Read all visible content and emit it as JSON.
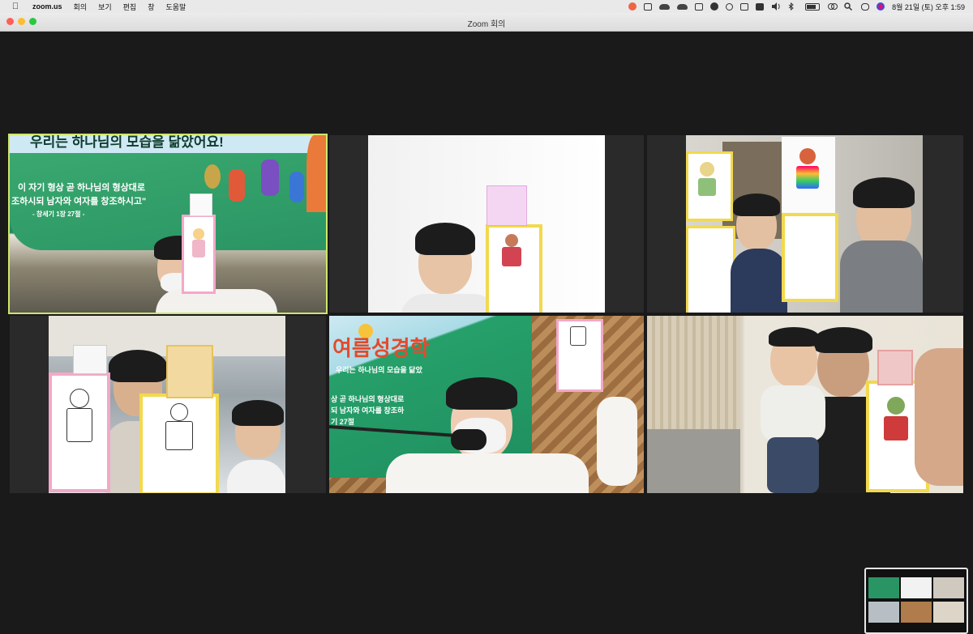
{
  "menubar": {
    "apple_icon": "apple-logo-icon",
    "app": "zoom.us",
    "menus": [
      "회의",
      "보기",
      "편집",
      "창",
      "도움말"
    ],
    "status_icons": [
      "zoom-share-icon",
      "camera-icon",
      "cloud-icon",
      "cloud-icon",
      "dashboard-icon",
      "contrast-icon",
      "play-icon",
      "window-icon",
      "translate-icon",
      "volume-icon",
      "bluetooth-icon",
      "battery-icon",
      "link-icon",
      "search-icon",
      "control-center-icon",
      "siri-icon"
    ],
    "clock": "8월 21일 (토) 오후 1:59"
  },
  "window": {
    "title": "Zoom 회의"
  },
  "tiles": {
    "t1": {
      "banner_line1": "우리는 하나님의 모습을 닮았어요!",
      "verse_line1": "이 자기 형상 곧 하나님의 형상대로",
      "verse_line2": "조하시되 남자와 여자를 창조하시고\"",
      "verse_ref": "- 창세기 1장 27절 -"
    },
    "t5": {
      "banner_big": "여름성경학",
      "banner_line1": "우리는 하나님의 모습을 닮았",
      "banner_line2": "상 곧 하나님의 형상대로",
      "banner_line3": "되 남자와 여자를 창조하",
      "banner_line4": "기 27절"
    }
  },
  "colors": {
    "active_speaker_border": "#cfe66b",
    "meeting_bg": "#1a1a1a",
    "card_pink": "#f3a8c8",
    "card_yellow": "#f2d94e"
  }
}
